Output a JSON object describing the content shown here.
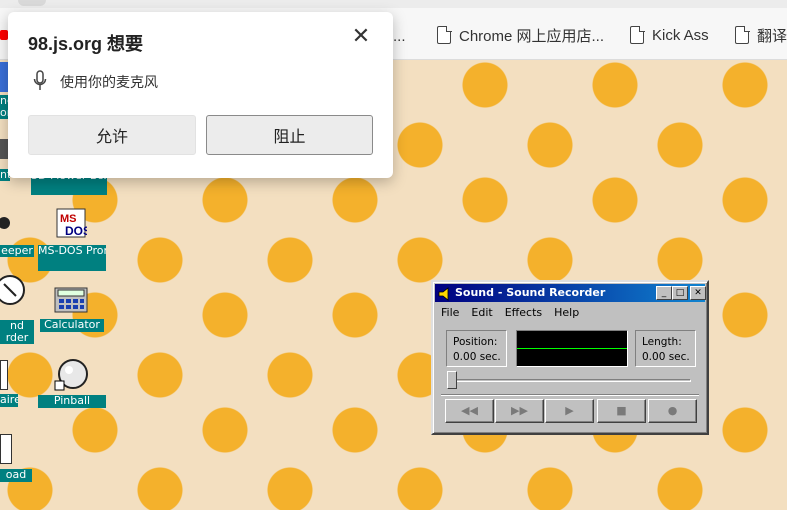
{
  "browser": {
    "bookmarks": [
      {
        "label": "色...",
        "icon": "document-icon"
      },
      {
        "label": "Chrome 网上应用店...",
        "icon": "document-icon"
      },
      {
        "label": "Kick Ass",
        "icon": "document-icon"
      },
      {
        "label": "翻译",
        "icon": "document-icon"
      }
    ]
  },
  "permission_popup": {
    "title": "98.js.org 想要",
    "request": "使用你的麦克风",
    "allow_label": "允许",
    "block_label": "阻止",
    "close_glyph": "✕"
  },
  "desktop": {
    "icons": [
      {
        "label": "3D Flower Box",
        "icon": "3d-flower-box-icon"
      },
      {
        "label": "MS-DOS Prompt",
        "icon": "ms-dos-icon"
      },
      {
        "label": "Calculator",
        "icon": "calculator-icon"
      },
      {
        "label": "Pinball",
        "icon": "pinball-icon"
      },
      {
        "label": "eeper",
        "icon": "minesweeper-icon"
      },
      {
        "label": "nd",
        "icon": "sound-recorder-icon"
      },
      {
        "label": "rder",
        "icon": "sound-recorder-icon"
      },
      {
        "label": "aire",
        "icon": "solitaire-icon"
      },
      {
        "label": "oad",
        "icon": "notepad-icon"
      },
      {
        "label": "ne",
        "icon": "partial-icon"
      },
      {
        "label": "or",
        "icon": "partial-icon"
      },
      {
        "label": "nt",
        "icon": "paint-icon"
      }
    ]
  },
  "sound_recorder": {
    "title": "Sound - Sound Recorder",
    "menu": [
      "File",
      "Edit",
      "Effects",
      "Help"
    ],
    "position_label": "Position:",
    "position_value": "0.00 sec.",
    "length_label": "Length:",
    "length_value": "0.00 sec.",
    "titlebar_buttons": {
      "minimize": "_",
      "maximize": "□",
      "close": "✕"
    },
    "controls": [
      {
        "name": "seek-start",
        "glyph": "◀◀"
      },
      {
        "name": "seek-end",
        "glyph": "▶▶"
      },
      {
        "name": "play",
        "glyph": "▶"
      },
      {
        "name": "stop",
        "glyph": "■"
      },
      {
        "name": "record",
        "glyph": "●"
      }
    ],
    "colors": {
      "titlebar": "#000080",
      "wave_line": "#00ff00",
      "face": "#c0c0c0"
    }
  },
  "theme": {
    "desktop_label_bg": "#008080",
    "wallpaper_bg": "#f3dfc0",
    "cat_color": "#f4b12c"
  }
}
